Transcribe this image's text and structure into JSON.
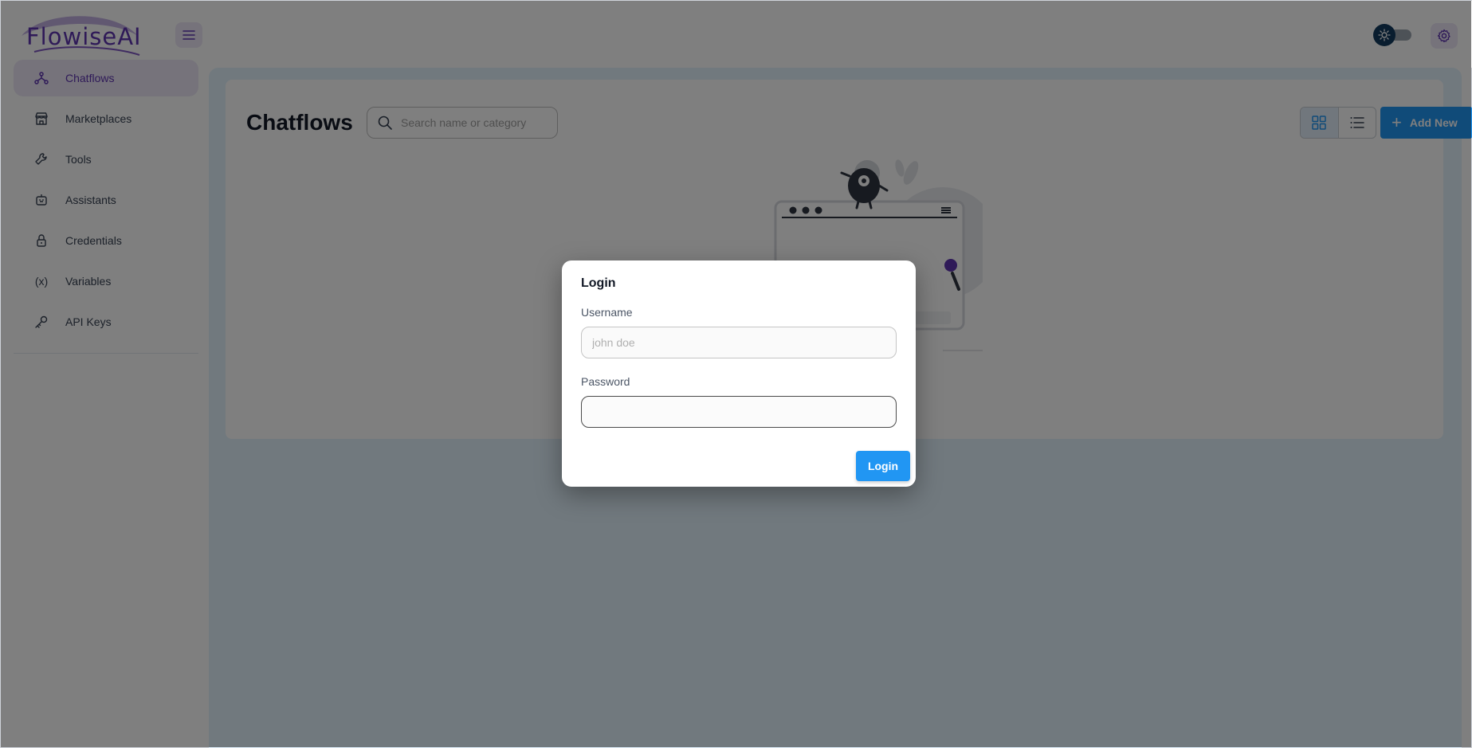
{
  "app": {
    "logo_text": "FlowiseAI"
  },
  "sidebar": {
    "items": [
      {
        "label": "Chatflows",
        "icon": "hierarchy-icon",
        "active": true
      },
      {
        "label": "Marketplaces",
        "icon": "building-store-icon",
        "active": false
      },
      {
        "label": "Tools",
        "icon": "tool-icon",
        "active": false
      },
      {
        "label": "Assistants",
        "icon": "robot-icon",
        "active": false
      },
      {
        "label": "Credentials",
        "icon": "lock-icon",
        "active": false
      },
      {
        "label": "Variables",
        "icon": "variable-icon",
        "active": false
      },
      {
        "label": "API Keys",
        "icon": "key-icon",
        "active": false
      }
    ]
  },
  "main": {
    "title": "Chatflows",
    "search_placeholder": "Search name or category",
    "add_new_label": "Add New"
  },
  "login_dialog": {
    "title": "Login",
    "username_label": "Username",
    "username_placeholder": "john doe",
    "password_label": "Password",
    "password_value": "",
    "submit_label": "Login"
  },
  "colors": {
    "accent": "#5e35b1",
    "primary_button": "#2196f3",
    "main_bg": "#e3f2fd",
    "active_nav_bg": "#ede7f6"
  }
}
